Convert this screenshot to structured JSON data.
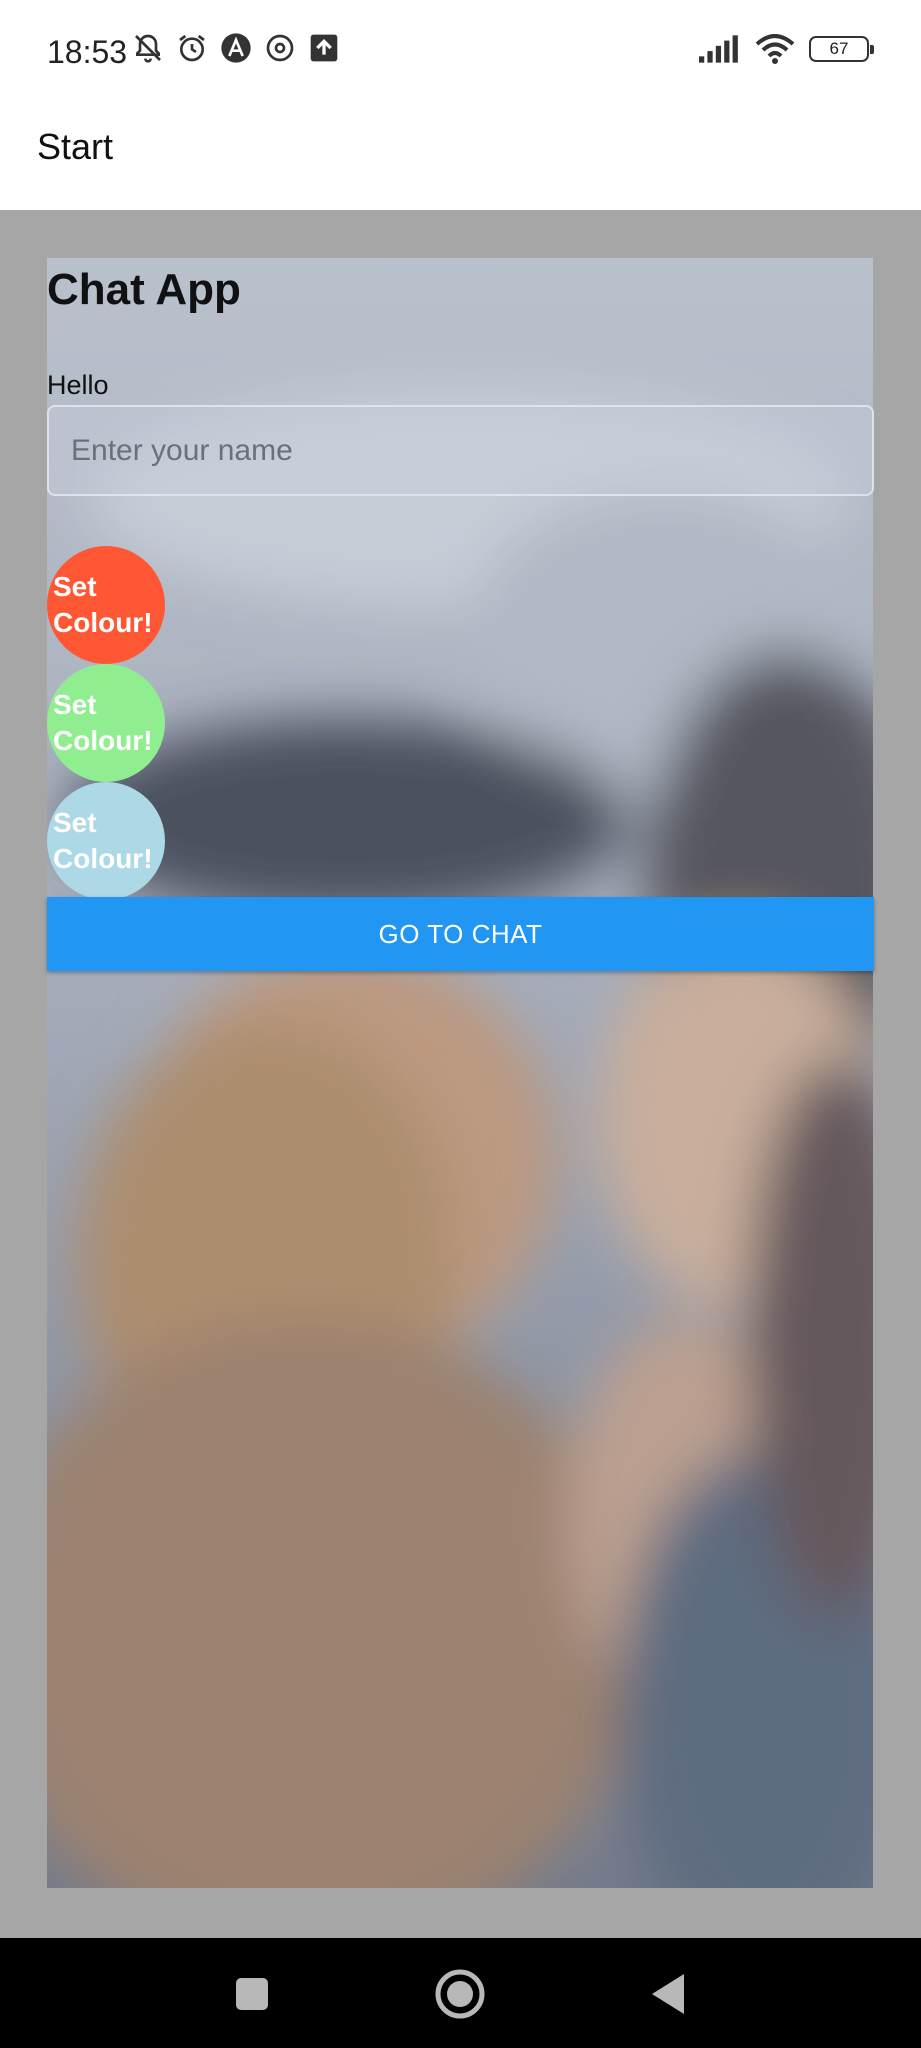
{
  "status_bar": {
    "time": "18:53",
    "battery": "67",
    "left_icons": [
      "muted-bell-icon",
      "alarm-icon",
      "app-a-icon",
      "threads-icon",
      "upload-icon"
    ],
    "right_icons": [
      "signal-icon",
      "wifi-icon",
      "battery-icon"
    ]
  },
  "app_bar": {
    "title": "Start"
  },
  "main": {
    "heading": "Chat App",
    "name_label": "Hello",
    "name_placeholder": "Enter your name",
    "name_value": "",
    "colour_buttons": [
      {
        "label": "Set Colour!",
        "color": "#ff5733"
      },
      {
        "label": "Set Colour!",
        "color": "#90ee90"
      },
      {
        "label": "Set Colour!",
        "color": "#add8e6"
      }
    ],
    "go_button": "GO TO CHAT"
  },
  "nav_bar": {
    "buttons": [
      "recents-square-icon",
      "home-circle-icon",
      "back-triangle-icon"
    ]
  },
  "colors": {
    "primary": "#2196f3",
    "screen_bg": "#a6a6a6"
  }
}
